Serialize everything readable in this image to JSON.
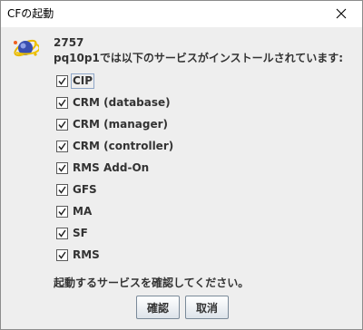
{
  "window": {
    "title": "CFの起動",
    "close_icon": "close-icon"
  },
  "dialog": {
    "icon": "app-globe-icon",
    "pid": "2757",
    "message": "pq10p1では以下のサービスがインストールされています:",
    "services": [
      {
        "label": "CIP",
        "checked": true
      },
      {
        "label": "CRM (database)",
        "checked": true
      },
      {
        "label": "CRM (manager)",
        "checked": true
      },
      {
        "label": "CRM (controller)",
        "checked": true
      },
      {
        "label": "RMS Add-On",
        "checked": true
      },
      {
        "label": "GFS",
        "checked": true
      },
      {
        "label": "MA",
        "checked": true
      },
      {
        "label": "SF",
        "checked": true
      },
      {
        "label": "RMS",
        "checked": true
      }
    ],
    "confirm_text": "起動するサービスを確認してください。",
    "ok_label": "確認",
    "cancel_label": "取消"
  }
}
